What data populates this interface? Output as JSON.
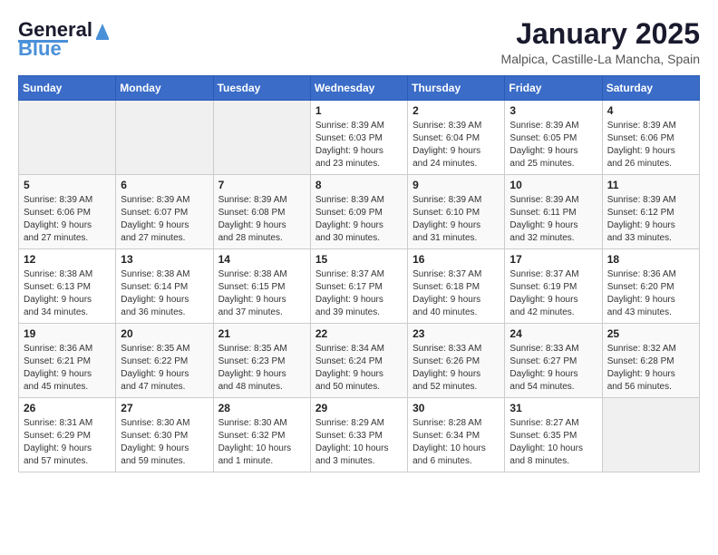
{
  "logo": {
    "line1": "General",
    "line2": "Blue"
  },
  "title": "January 2025",
  "location": "Malpica, Castille-La Mancha, Spain",
  "weekdays": [
    "Sunday",
    "Monday",
    "Tuesday",
    "Wednesday",
    "Thursday",
    "Friday",
    "Saturday"
  ],
  "weeks": [
    [
      {
        "day": "",
        "info": ""
      },
      {
        "day": "",
        "info": ""
      },
      {
        "day": "",
        "info": ""
      },
      {
        "day": "1",
        "info": "Sunrise: 8:39 AM\nSunset: 6:03 PM\nDaylight: 9 hours\nand 23 minutes."
      },
      {
        "day": "2",
        "info": "Sunrise: 8:39 AM\nSunset: 6:04 PM\nDaylight: 9 hours\nand 24 minutes."
      },
      {
        "day": "3",
        "info": "Sunrise: 8:39 AM\nSunset: 6:05 PM\nDaylight: 9 hours\nand 25 minutes."
      },
      {
        "day": "4",
        "info": "Sunrise: 8:39 AM\nSunset: 6:06 PM\nDaylight: 9 hours\nand 26 minutes."
      }
    ],
    [
      {
        "day": "5",
        "info": "Sunrise: 8:39 AM\nSunset: 6:06 PM\nDaylight: 9 hours\nand 27 minutes."
      },
      {
        "day": "6",
        "info": "Sunrise: 8:39 AM\nSunset: 6:07 PM\nDaylight: 9 hours\nand 27 minutes."
      },
      {
        "day": "7",
        "info": "Sunrise: 8:39 AM\nSunset: 6:08 PM\nDaylight: 9 hours\nand 28 minutes."
      },
      {
        "day": "8",
        "info": "Sunrise: 8:39 AM\nSunset: 6:09 PM\nDaylight: 9 hours\nand 30 minutes."
      },
      {
        "day": "9",
        "info": "Sunrise: 8:39 AM\nSunset: 6:10 PM\nDaylight: 9 hours\nand 31 minutes."
      },
      {
        "day": "10",
        "info": "Sunrise: 8:39 AM\nSunset: 6:11 PM\nDaylight: 9 hours\nand 32 minutes."
      },
      {
        "day": "11",
        "info": "Sunrise: 8:39 AM\nSunset: 6:12 PM\nDaylight: 9 hours\nand 33 minutes."
      }
    ],
    [
      {
        "day": "12",
        "info": "Sunrise: 8:38 AM\nSunset: 6:13 PM\nDaylight: 9 hours\nand 34 minutes."
      },
      {
        "day": "13",
        "info": "Sunrise: 8:38 AM\nSunset: 6:14 PM\nDaylight: 9 hours\nand 36 minutes."
      },
      {
        "day": "14",
        "info": "Sunrise: 8:38 AM\nSunset: 6:15 PM\nDaylight: 9 hours\nand 37 minutes."
      },
      {
        "day": "15",
        "info": "Sunrise: 8:37 AM\nSunset: 6:17 PM\nDaylight: 9 hours\nand 39 minutes."
      },
      {
        "day": "16",
        "info": "Sunrise: 8:37 AM\nSunset: 6:18 PM\nDaylight: 9 hours\nand 40 minutes."
      },
      {
        "day": "17",
        "info": "Sunrise: 8:37 AM\nSunset: 6:19 PM\nDaylight: 9 hours\nand 42 minutes."
      },
      {
        "day": "18",
        "info": "Sunrise: 8:36 AM\nSunset: 6:20 PM\nDaylight: 9 hours\nand 43 minutes."
      }
    ],
    [
      {
        "day": "19",
        "info": "Sunrise: 8:36 AM\nSunset: 6:21 PM\nDaylight: 9 hours\nand 45 minutes."
      },
      {
        "day": "20",
        "info": "Sunrise: 8:35 AM\nSunset: 6:22 PM\nDaylight: 9 hours\nand 47 minutes."
      },
      {
        "day": "21",
        "info": "Sunrise: 8:35 AM\nSunset: 6:23 PM\nDaylight: 9 hours\nand 48 minutes."
      },
      {
        "day": "22",
        "info": "Sunrise: 8:34 AM\nSunset: 6:24 PM\nDaylight: 9 hours\nand 50 minutes."
      },
      {
        "day": "23",
        "info": "Sunrise: 8:33 AM\nSunset: 6:26 PM\nDaylight: 9 hours\nand 52 minutes."
      },
      {
        "day": "24",
        "info": "Sunrise: 8:33 AM\nSunset: 6:27 PM\nDaylight: 9 hours\nand 54 minutes."
      },
      {
        "day": "25",
        "info": "Sunrise: 8:32 AM\nSunset: 6:28 PM\nDaylight: 9 hours\nand 56 minutes."
      }
    ],
    [
      {
        "day": "26",
        "info": "Sunrise: 8:31 AM\nSunset: 6:29 PM\nDaylight: 9 hours\nand 57 minutes."
      },
      {
        "day": "27",
        "info": "Sunrise: 8:30 AM\nSunset: 6:30 PM\nDaylight: 9 hours\nand 59 minutes."
      },
      {
        "day": "28",
        "info": "Sunrise: 8:30 AM\nSunset: 6:32 PM\nDaylight: 10 hours\nand 1 minute."
      },
      {
        "day": "29",
        "info": "Sunrise: 8:29 AM\nSunset: 6:33 PM\nDaylight: 10 hours\nand 3 minutes."
      },
      {
        "day": "30",
        "info": "Sunrise: 8:28 AM\nSunset: 6:34 PM\nDaylight: 10 hours\nand 6 minutes."
      },
      {
        "day": "31",
        "info": "Sunrise: 8:27 AM\nSunset: 6:35 PM\nDaylight: 10 hours\nand 8 minutes."
      },
      {
        "day": "",
        "info": ""
      }
    ]
  ]
}
